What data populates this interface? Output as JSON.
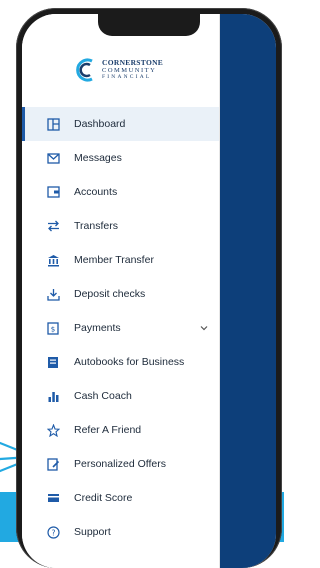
{
  "brand": {
    "line1": "CORNERSTONE",
    "line2": "COMMUNITY",
    "line3": "FINANCIAL"
  },
  "colors": {
    "accent": "#1f5ba8",
    "panel": "#0d3f7a",
    "band": "#22a9e1"
  },
  "menu": {
    "items": [
      {
        "label": "Dashboard",
        "icon": "dashboard-icon"
      },
      {
        "label": "Messages",
        "icon": "envelope-icon"
      },
      {
        "label": "Accounts",
        "icon": "wallet-icon"
      },
      {
        "label": "Transfers",
        "icon": "arrows-exchange-icon"
      },
      {
        "label": "Member Transfer",
        "icon": "bank-icon"
      },
      {
        "label": "Deposit checks",
        "icon": "download-tray-icon"
      },
      {
        "label": "Payments",
        "icon": "payment-doc-icon"
      },
      {
        "label": "Autobooks for Business",
        "icon": "ledger-icon"
      },
      {
        "label": "Cash Coach",
        "icon": "bar-chart-icon"
      },
      {
        "label": "Refer A Friend",
        "icon": "star-icon"
      },
      {
        "label": "Personalized Offers",
        "icon": "offers-icon"
      },
      {
        "label": "Credit Score",
        "icon": "card-icon"
      },
      {
        "label": "Support",
        "icon": "question-icon"
      }
    ]
  }
}
